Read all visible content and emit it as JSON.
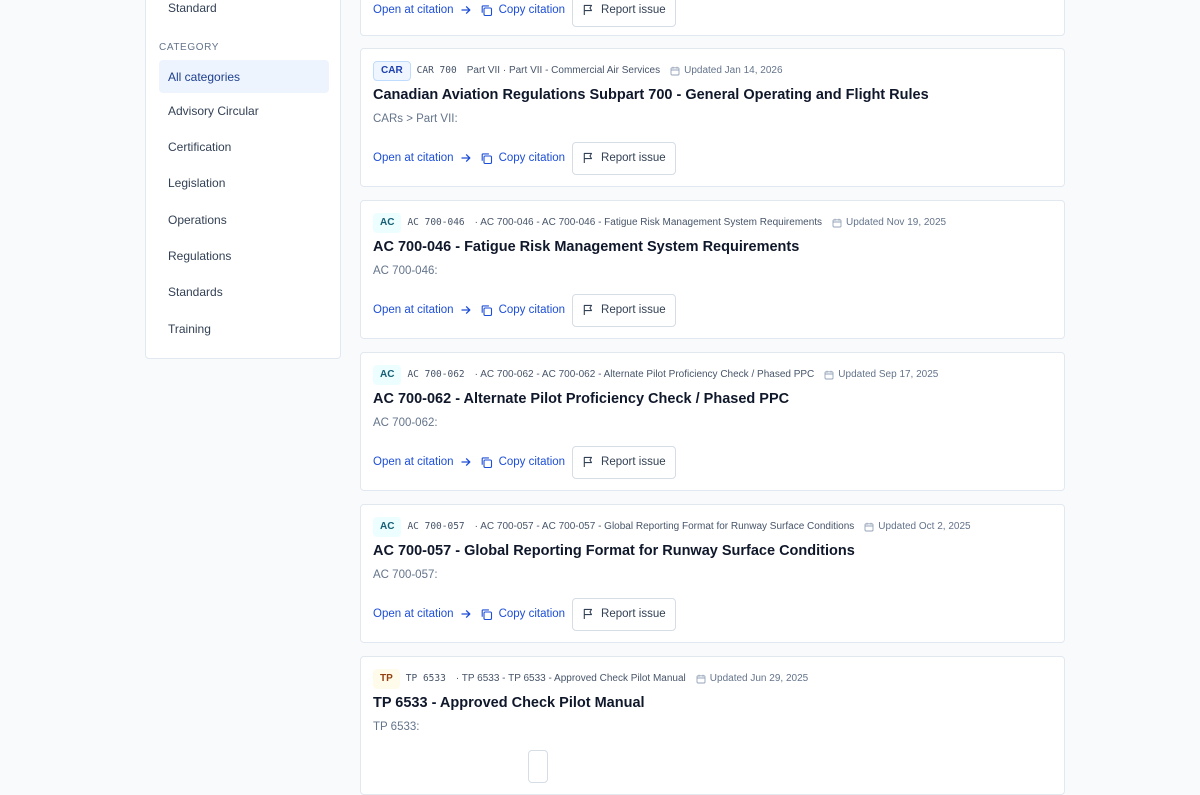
{
  "sidebar": {
    "top_item": "Standard",
    "category_heading": "CATEGORY",
    "categories": [
      "All categories",
      "Advisory Circular",
      "Certification",
      "Legislation",
      "Operations",
      "Regulations",
      "Standards",
      "Training"
    ],
    "selected_category": "All categories"
  },
  "actions": {
    "open_label": "Open at citation",
    "copy_label": "Copy citation",
    "report_label": "Report issue"
  },
  "results": [
    {
      "badge": "",
      "code": "",
      "path": "",
      "updated": "",
      "title": "",
      "snippet": ""
    },
    {
      "badge": "CAR",
      "code": "CAR 700",
      "path": "Part VII · Part VII - Commercial Air Services",
      "updated": "Updated Jan 14, 2026",
      "title": "Canadian Aviation Regulations Subpart 700 - General Operating and Flight Rules",
      "snippet": "CARs > Part VII:"
    },
    {
      "badge": "AC",
      "code": "AC 700-046",
      "path": "· AC 700-046 - AC 700-046 - Fatigue Risk Management System Requirements",
      "updated": "Updated Nov 19, 2025",
      "title": "AC 700-046 - Fatigue Risk Management System Requirements",
      "snippet": "AC 700-046:"
    },
    {
      "badge": "AC",
      "code": "AC 700-062",
      "path": "· AC 700-062 - AC 700-062 - Alternate Pilot Proficiency Check / Phased PPC",
      "updated": "Updated Sep 17, 2025",
      "title": "AC 700-062 - Alternate Pilot Proficiency Check / Phased PPC",
      "snippet": "AC 700-062:"
    },
    {
      "badge": "AC",
      "code": "AC 700-057",
      "path": "· AC 700-057 - AC 700-057 - Global Reporting Format for Runway Surface Conditions",
      "updated": "Updated Oct 2, 2025",
      "title": "AC 700-057 - Global Reporting Format for Runway Surface Conditions",
      "snippet": "AC 700-057:"
    },
    {
      "badge": "TP",
      "code": "TP 6533",
      "path": "· TP 6533 - TP 6533 - Approved Check Pilot Manual",
      "updated": "Updated Jun 29, 2025",
      "title": "TP 6533 - Approved Check Pilot Manual",
      "snippet": "TP 6533:"
    }
  ],
  "colors": {
    "accent": "#1d4ed8",
    "active_bg": "#eef4fd",
    "card_border": "#e2e8f0",
    "badge_car": "#1e40af",
    "badge_ac": "#155e75",
    "badge_tp": "#92400e"
  },
  "icons": {
    "open": "arrow-right-icon",
    "copy": "copy-icon",
    "report": "flag-icon",
    "updated": "calendar-icon"
  }
}
